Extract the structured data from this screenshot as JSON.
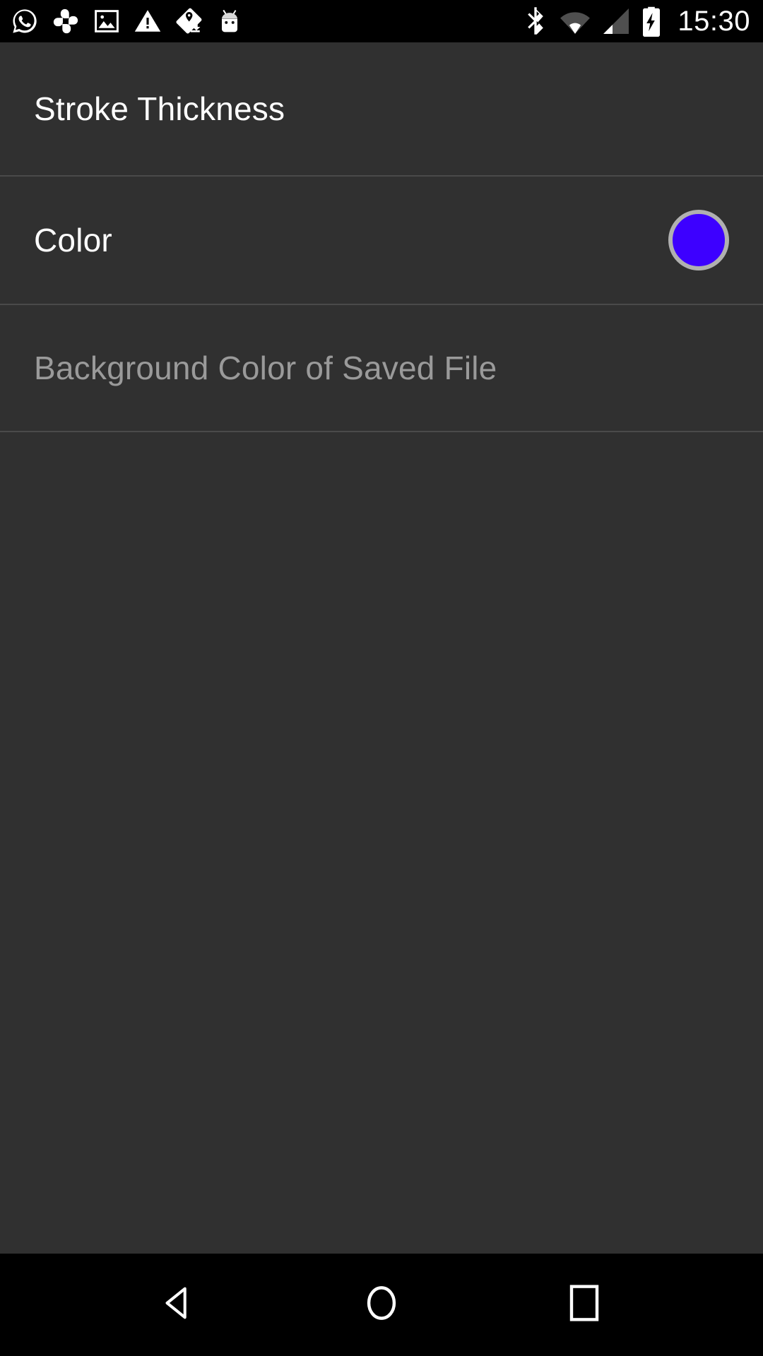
{
  "status_bar": {
    "time": "15:30",
    "notification_icons": [
      {
        "name": "whatsapp-icon",
        "label": "WhatsApp"
      },
      {
        "name": "photos-pinwheel-icon",
        "label": "Google Photos"
      },
      {
        "name": "image-icon",
        "label": "Screenshot captured"
      },
      {
        "name": "warning-triangle-icon",
        "label": "Warning"
      },
      {
        "name": "map-location-icon",
        "label": "Maps offline area"
      },
      {
        "name": "android-mascot-icon",
        "label": "Android System"
      }
    ],
    "system_icons": [
      {
        "name": "bluetooth-icon",
        "label": "Bluetooth"
      },
      {
        "name": "wifi-icon",
        "label": "Wi-Fi signal"
      },
      {
        "name": "cellular-signal-icon",
        "label": "Cellular signal"
      },
      {
        "name": "battery-charging-icon",
        "label": "Battery charging"
      }
    ]
  },
  "settings_list": {
    "items": [
      {
        "key": "stroke_thickness",
        "label": "Stroke Thickness",
        "enabled": true,
        "accessory": "none"
      },
      {
        "key": "color",
        "label": "Color",
        "enabled": true,
        "accessory": "color-swatch",
        "swatch_color": "#3D00FF",
        "swatch_border_color": "#B0B0B0"
      },
      {
        "key": "background_color_saved_file",
        "label": "Background Color of Saved File",
        "enabled": false,
        "accessory": "none"
      }
    ]
  },
  "nav_bar": {
    "buttons": [
      {
        "name": "back-button",
        "label": "Back"
      },
      {
        "name": "home-button",
        "label": "Home"
      },
      {
        "name": "recents-button",
        "label": "Recent apps"
      }
    ]
  },
  "theme": {
    "background": "#303030",
    "status_bar_background": "#000000",
    "nav_bar_background": "#000000",
    "divider": "#4A4A4A",
    "text_primary": "#FFFFFF",
    "text_disabled": "#9A9A9A"
  }
}
